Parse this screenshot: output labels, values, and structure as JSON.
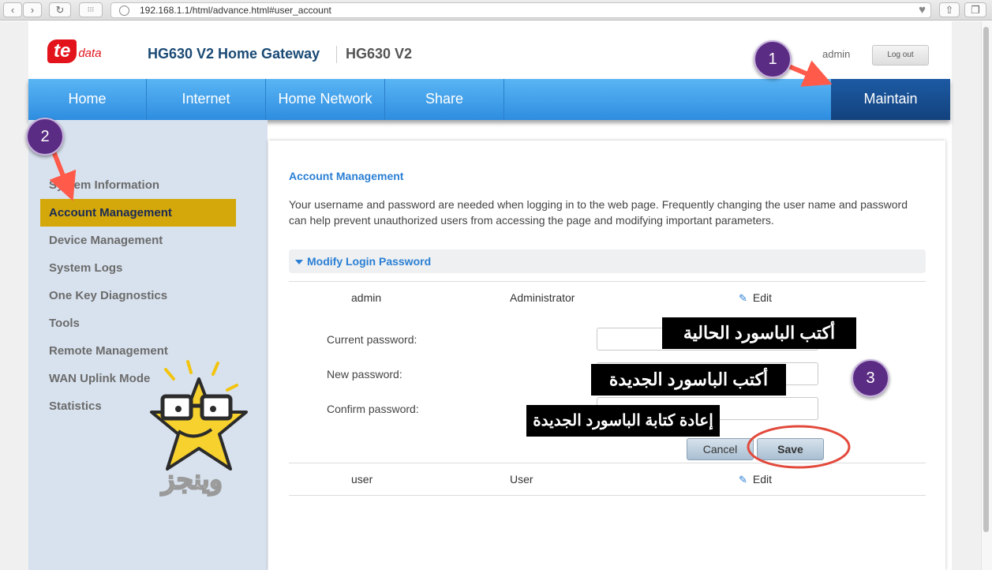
{
  "browser": {
    "back_icon": "‹",
    "forward_icon": "›",
    "reload_icon": "↻",
    "grid_icon": "⁝⁝⁝",
    "url": "192.168.1.1/html/advance.html#user_account",
    "heart_icon": "♥",
    "share_icon": "⇧",
    "tabs_icon": "❐"
  },
  "header": {
    "logo_te": "te",
    "logo_data": "data",
    "title": "HG630 V2 Home Gateway",
    "model": "HG630 V2",
    "user": "admin",
    "logout": "Log out"
  },
  "nav": {
    "items": [
      {
        "label": "Home"
      },
      {
        "label": "Internet"
      },
      {
        "label": "Home Network"
      },
      {
        "label": "Share"
      },
      {
        "label": "Maintain"
      }
    ],
    "active": "Maintain"
  },
  "sidebar": {
    "items": [
      {
        "label": "System Information"
      },
      {
        "label": "Account Management"
      },
      {
        "label": "Device Management"
      },
      {
        "label": "System Logs"
      },
      {
        "label": "One Key Diagnostics"
      },
      {
        "label": "Tools"
      },
      {
        "label": "Remote Management"
      },
      {
        "label": "WAN Uplink Mode"
      },
      {
        "label": "Statistics"
      }
    ],
    "active": "Account Management"
  },
  "content": {
    "title": "Account Management",
    "description": "Your username and password are needed when logging in to the web page. Frequently changing the user name and password can help prevent unauthorized users from accessing the page and modifying important parameters.",
    "panel_title": "Modify Login Password",
    "accounts": [
      {
        "username": "admin",
        "role": "Administrator",
        "action": "Edit"
      },
      {
        "username": "user",
        "role": "User",
        "action": "Edit"
      }
    ],
    "form": {
      "current_label": "Current password:",
      "new_label": "New password:",
      "confirm_label": "Confirm password:",
      "cancel": "Cancel",
      "save": "Save"
    }
  },
  "annotations": {
    "step1": "1",
    "step2": "2",
    "step3": "3",
    "note_current": "أكتب الباسورد الحالية",
    "note_new": "أكتب الباسورد الجديدة",
    "note_confirm": "إعادة كتابة الباسورد الجديدة",
    "mascot_text": "وينجز",
    "accent_color": "#5b2c83",
    "arrow_color": "#ff5a4a"
  }
}
